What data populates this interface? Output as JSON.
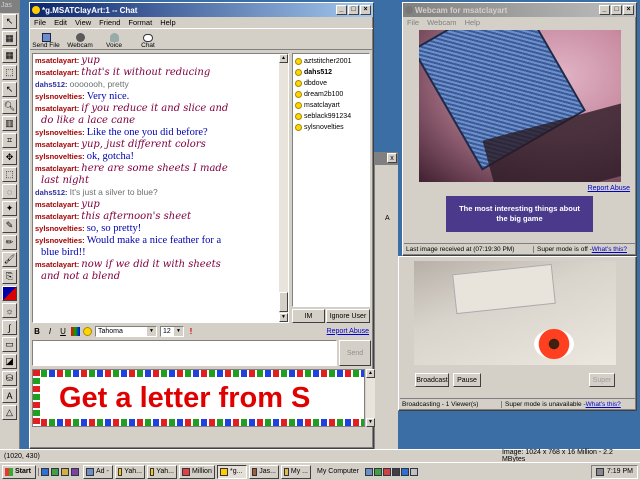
{
  "desktop_bits": {
    "top_left": "Jas",
    "mid_left_label": "A"
  },
  "chat": {
    "title": "*g.MSATClayArt:1 -- Chat",
    "menu": [
      "File",
      "Edit",
      "View",
      "Friend",
      "Format",
      "Help"
    ],
    "toolbar": [
      {
        "label": "Send File"
      },
      {
        "label": "Webcam"
      },
      {
        "label": "Voice"
      },
      {
        "label": "Chat"
      }
    ],
    "messages": [
      {
        "nick": "msatclayart",
        "text": "yup",
        "style": "it",
        "color": "#800040",
        "ncolor": "#a00000"
      },
      {
        "nick": "msatclayart",
        "text": "that's it without reducing",
        "style": "it",
        "color": "#800040",
        "ncolor": "#a00000"
      },
      {
        "nick": "dahs512",
        "text": "ooooooh, pretty",
        "style": "ss",
        "color": "#6b7070",
        "ncolor": "#3030a0"
      },
      {
        "nick": "sylsnovelties",
        "text": "Very nice.",
        "style": "sf",
        "color": "#0000b0",
        "ncolor": "#a00000"
      },
      {
        "nick": "msatclayart",
        "text": "if you reduce it and slice and",
        "cont": "do like a lace cane",
        "style": "it",
        "color": "#800040",
        "ncolor": "#a00000"
      },
      {
        "nick": "sylsnovelties",
        "text": "Like the one you did before?",
        "style": "sf",
        "color": "#0000b0",
        "ncolor": "#a00000"
      },
      {
        "nick": "msatclayart",
        "text": "yup, just different colors",
        "style": "it",
        "color": "#800040",
        "ncolor": "#a00000"
      },
      {
        "nick": "sylsnovelties",
        "text": "ok, gotcha!",
        "style": "sf",
        "color": "#0000b0",
        "ncolor": "#a00000"
      },
      {
        "nick": "msatclayart",
        "text": "here are some sheets I made",
        "cont": "last night",
        "style": "it",
        "color": "#800040",
        "ncolor": "#a00000"
      },
      {
        "nick": "dahs512",
        "text": "It's just a silver to blue?",
        "style": "ss",
        "color": "#6b7070",
        "ncolor": "#3030a0"
      },
      {
        "nick": "msatclayart",
        "text": "yup",
        "style": "it",
        "color": "#800040",
        "ncolor": "#a00000"
      },
      {
        "nick": "msatclayart",
        "text": "this afternoon's sheet",
        "style": "it",
        "color": "#800040",
        "ncolor": "#a00000"
      },
      {
        "nick": "sylsnovelties",
        "text": "so, so pretty!",
        "style": "sf",
        "color": "#0000b0",
        "ncolor": "#a00000"
      },
      {
        "nick": "sylsnovelties",
        "text": "Would make a nice feather for a",
        "cont": "blue bird!!",
        "style": "sf",
        "color": "#0000b0",
        "ncolor": "#a00000"
      },
      {
        "nick": "msatclayart",
        "text": "now if we did it with sheets",
        "cont": "and not a blend",
        "style": "it",
        "color": "#800040",
        "ncolor": "#a00000"
      }
    ],
    "users": [
      {
        "name": "aztstitcher2001",
        "bold": false
      },
      {
        "name": "dahs512",
        "bold": true
      },
      {
        "name": "dbdove",
        "bold": false
      },
      {
        "name": "dream2b100",
        "bold": false
      },
      {
        "name": "msatclayart",
        "bold": false
      },
      {
        "name": "seblack991234",
        "bold": false
      },
      {
        "name": "sylsnovelties",
        "bold": false
      }
    ],
    "im_label": "IM",
    "ignore_label": "Ignore User",
    "report_abuse": "Report Abuse",
    "format": {
      "bold": "B",
      "italic": "I",
      "underline": "U",
      "font": "Tahoma",
      "size": "12"
    },
    "input_value": "",
    "send_label": "Send",
    "banner_text": "Get a letter from S"
  },
  "webcam1": {
    "title": "Webcam for msatclayart",
    "menu": [
      "File",
      "Webcam",
      "Help"
    ],
    "report_abuse": "Report Abuse",
    "ad_text": "The most interesting things about the big game",
    "last_image": "Last image received at (07:19:30 PM)",
    "super_mode": "Super mode is off - ",
    "whats_this": "What's this?"
  },
  "webcam2": {
    "broadcast_label": "Broadcast",
    "pause_label": "Pause",
    "super_label": "Super",
    "status": "Broadcasting - 1 Viewer(s)",
    "super_mode": "Super mode is unavailable - ",
    "whats_this": "What's this?"
  },
  "bg_status": {
    "coords": "(1020, 430)",
    "image_info": "Image:  1024 x 768 x 16 Million - 2.2 MBytes"
  },
  "taskbar": {
    "start": "Start",
    "buttons": [
      "Ad -",
      "Yah...",
      "Yah...",
      "Million",
      "*g...",
      "Jas...",
      "My ..."
    ],
    "my_computer": "My Computer",
    "clock": "7:19 PM"
  },
  "colors": {
    "titlebar": "#0a246a",
    "face": "#d4d0c8",
    "desktop": "#3a6ea5",
    "ad_bg": "#4b3a8c",
    "banner_text": "#e00000"
  }
}
